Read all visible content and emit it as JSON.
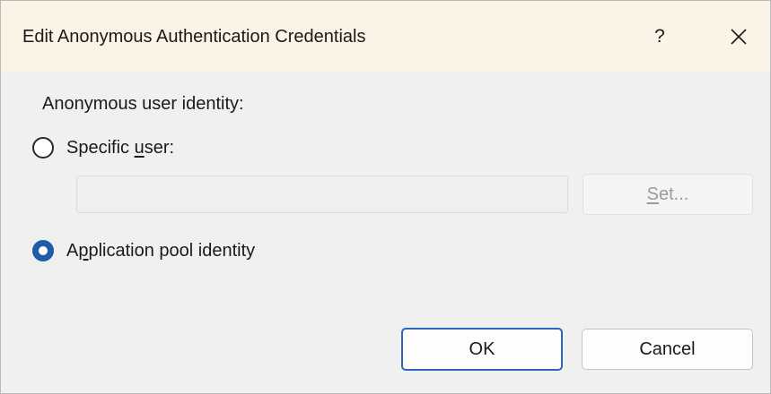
{
  "window": {
    "title": "Edit Anonymous Authentication Credentials",
    "help_label": "?",
    "close_icon": "close-icon"
  },
  "identity": {
    "group_label": "Anonymous user identity:",
    "specific_user": {
      "label_before": "Specific ",
      "label_mnemonic": "u",
      "label_after": "ser:",
      "selected": false,
      "username_value": "",
      "set_button": {
        "mnemonic": "S",
        "label_after": "et...",
        "enabled": false
      }
    },
    "app_pool": {
      "label_before": "A",
      "label_mnemonic": "p",
      "label_after": "plication pool identity",
      "selected": true
    }
  },
  "buttons": {
    "ok_label": "OK",
    "cancel_label": "Cancel"
  },
  "colors": {
    "title_bar": "#fbf4e6",
    "accent": "#1e5ca8",
    "disabled_text": "#9b9b9b"
  }
}
